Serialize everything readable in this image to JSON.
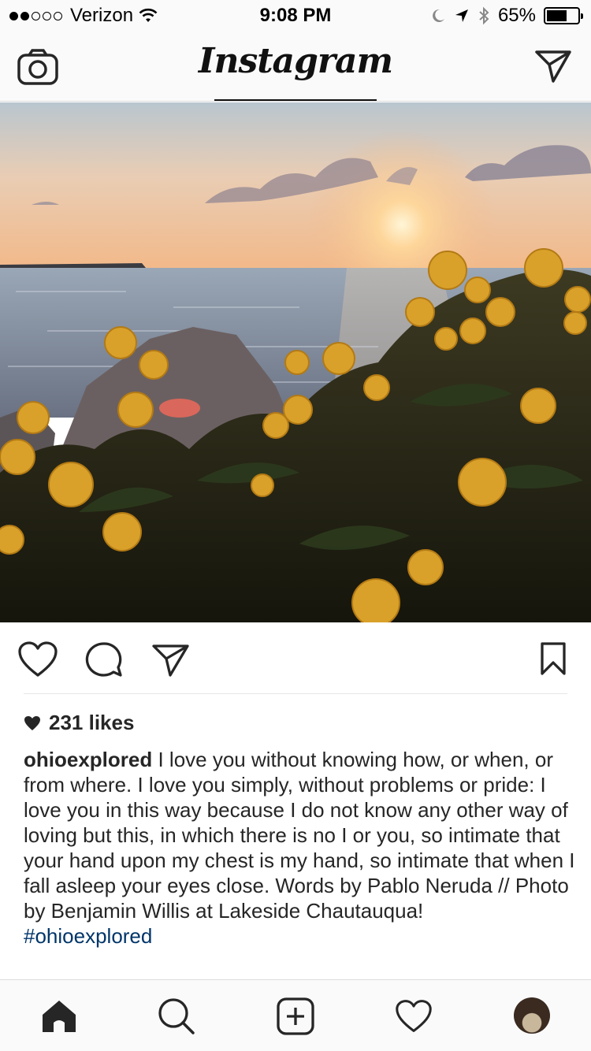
{
  "status_bar": {
    "carrier": "Verizon",
    "time": "9:08 PM",
    "battery": "65%",
    "battery_level": 0.65,
    "icons": [
      "signal-dots-icon",
      "wifi-icon",
      "moon-icon",
      "location-arrow-icon",
      "bluetooth-icon",
      "battery-icon"
    ]
  },
  "nav": {
    "title": "Instagram",
    "left_icon": "camera-icon",
    "right_icon": "direct-message-icon"
  },
  "post": {
    "image_alt": "sunset-over-lake-with-yellow-flowers",
    "actions": [
      "like-heart-icon",
      "comment-bubble-icon",
      "share-paper-plane-icon",
      "save-bookmark-icon"
    ],
    "likes": "231 likes",
    "username": "ohioexplored",
    "caption": " I love you without knowing how, or when, or from where. I love you simply, without problems or pride: I love you in this way because I do not know any other way of loving but this, in which there is no I or you, so intimate that your hand upon my chest is my hand, so intimate that when I fall asleep your eyes close. Words by Pablo Neruda // Photo by Benjamin Willis at Lakeside Chautauqua!",
    "hashtag": "#ohioexplored"
  },
  "tab_bar": {
    "items": [
      "home-icon",
      "search-icon",
      "new-post-icon",
      "activity-heart-icon",
      "profile-avatar"
    ],
    "active": "home-icon"
  },
  "colors": {
    "hashtag": "#003569",
    "text": "#262626",
    "bar_bg": "#fafafa",
    "divider": "#dbdbdb"
  }
}
